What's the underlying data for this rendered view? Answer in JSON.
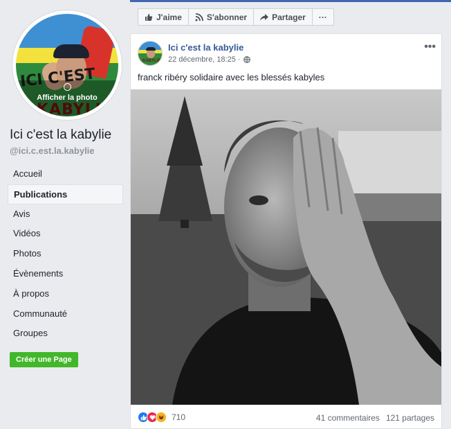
{
  "sidebar": {
    "profile_overlay_label": "Afficher la photo",
    "avatar_text_top": "ICI C'EST",
    "avatar_text_bottom": "KABYLIE",
    "page_name": "Ici c'est la kabylie",
    "page_handle": "@ici.c.est.la.kabylie",
    "nav": [
      {
        "label": "Accueil",
        "active": false
      },
      {
        "label": "Publications",
        "active": true
      },
      {
        "label": "Avis",
        "active": false
      },
      {
        "label": "Vidéos",
        "active": false
      },
      {
        "label": "Photos",
        "active": false
      },
      {
        "label": "Évènements",
        "active": false
      },
      {
        "label": "À propos",
        "active": false
      },
      {
        "label": "Communauté",
        "active": false
      },
      {
        "label": "Groupes",
        "active": false
      }
    ],
    "create_page_label": "Créer une Page"
  },
  "action_bar": {
    "like_label": "J'aime",
    "subscribe_label": "S'abonner",
    "share_label": "Partager",
    "more_label": "···"
  },
  "post": {
    "author": "Ici c'est la kabylie",
    "timestamp": "22 décembre, 18:25 ·",
    "text": "franck ribéry solidaire avec les blessés kabyles",
    "more_label": "•••",
    "reaction_count": "710",
    "comments": "41 commentaires",
    "shares": "121 partages"
  },
  "colors": {
    "background": "#e9ebee",
    "link_blue": "#365899",
    "create_green": "#42b72a",
    "like_blue": "#2078f4",
    "love_red": "#f0284a",
    "haha_yellow": "#f7b125"
  },
  "icons": [
    "thumbs-up-icon",
    "rss-icon",
    "share-arrow-icon",
    "more-dots-icon",
    "globe-icon",
    "camera-icon"
  ]
}
